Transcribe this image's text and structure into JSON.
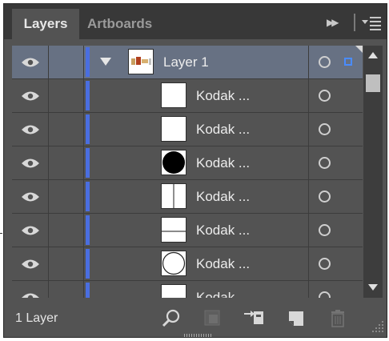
{
  "tabs": [
    {
      "label": "Layers",
      "active": true
    },
    {
      "label": "Artboards",
      "active": false
    }
  ],
  "toolbar": {
    "forward_icon": "fast-forward-icon",
    "menu_icon": "panel-menu-icon"
  },
  "top_layer": {
    "name": "Layer 1",
    "expanded": true,
    "color": "#4a6ee0",
    "selected": true
  },
  "sublayers": [
    {
      "name": "Kodak ...",
      "thumb": "blank"
    },
    {
      "name": "Kodak ...",
      "thumb": "blank"
    },
    {
      "name": "Kodak ...",
      "thumb": "black-circle"
    },
    {
      "name": "Kodak ...",
      "thumb": "vertical-line"
    },
    {
      "name": "Kodak ...",
      "thumb": "horizontal-line"
    },
    {
      "name": "Kodak ...",
      "thumb": "outline-circle"
    },
    {
      "name": "Kodak",
      "thumb": "blank"
    }
  ],
  "footer": {
    "layer_count": "1 Layer",
    "icons": [
      "locate-object-icon",
      "make-clipping-mask-icon",
      "create-sublayer-icon",
      "create-new-layer-icon",
      "delete-icon"
    ]
  },
  "colors": {
    "panel_bg": "#535353",
    "tab_bar": "#383838",
    "selection_row": "#677183",
    "layer_color": "#4a6ee0",
    "selected_square": "#4a8cff"
  }
}
